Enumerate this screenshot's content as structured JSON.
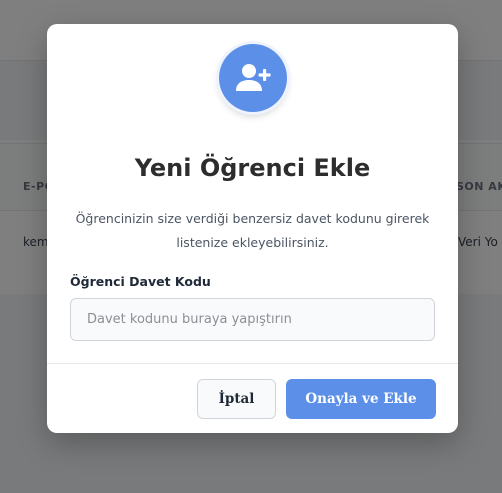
{
  "background": {
    "table_header_left": "E-PO",
    "table_header_right": "SON AK",
    "row_left": "kem",
    "row_right": "Veri Yo"
  },
  "modal": {
    "icon": "user-plus-icon",
    "title": "Yeni Öğrenci Ekle",
    "description": "Öğrencinizin size verdiği benzersiz davet kodunu girerek listenize ekleyebilirsiniz.",
    "field_label": "Öğrenci Davet Kodu",
    "field_value": "",
    "field_placeholder": "Davet kodunu buraya yapıştırın",
    "cancel_label": "İptal",
    "confirm_label": "Onayla ve Ekle"
  },
  "colors": {
    "accent": "#5b8fe8",
    "overlay": "rgba(0,0,0,0.5)"
  }
}
